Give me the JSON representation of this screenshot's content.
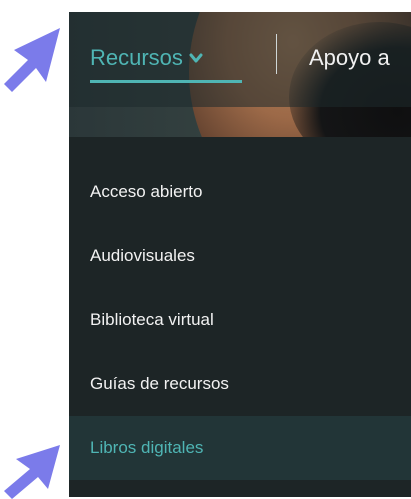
{
  "header": {
    "nav_resources": "Recursos",
    "nav_apoyo": "Apoyo a"
  },
  "menu": {
    "items": [
      {
        "label": "Acceso abierto"
      },
      {
        "label": "Audiovisuales"
      },
      {
        "label": "Biblioteca virtual"
      },
      {
        "label": "Guías de recursos"
      },
      {
        "label": "Libros digitales"
      }
    ],
    "active_index": 4
  },
  "colors": {
    "accent": "#4fb5b4",
    "panel": "#1d2526",
    "active_bg": "#223537",
    "arrow": "#7b7bea"
  }
}
